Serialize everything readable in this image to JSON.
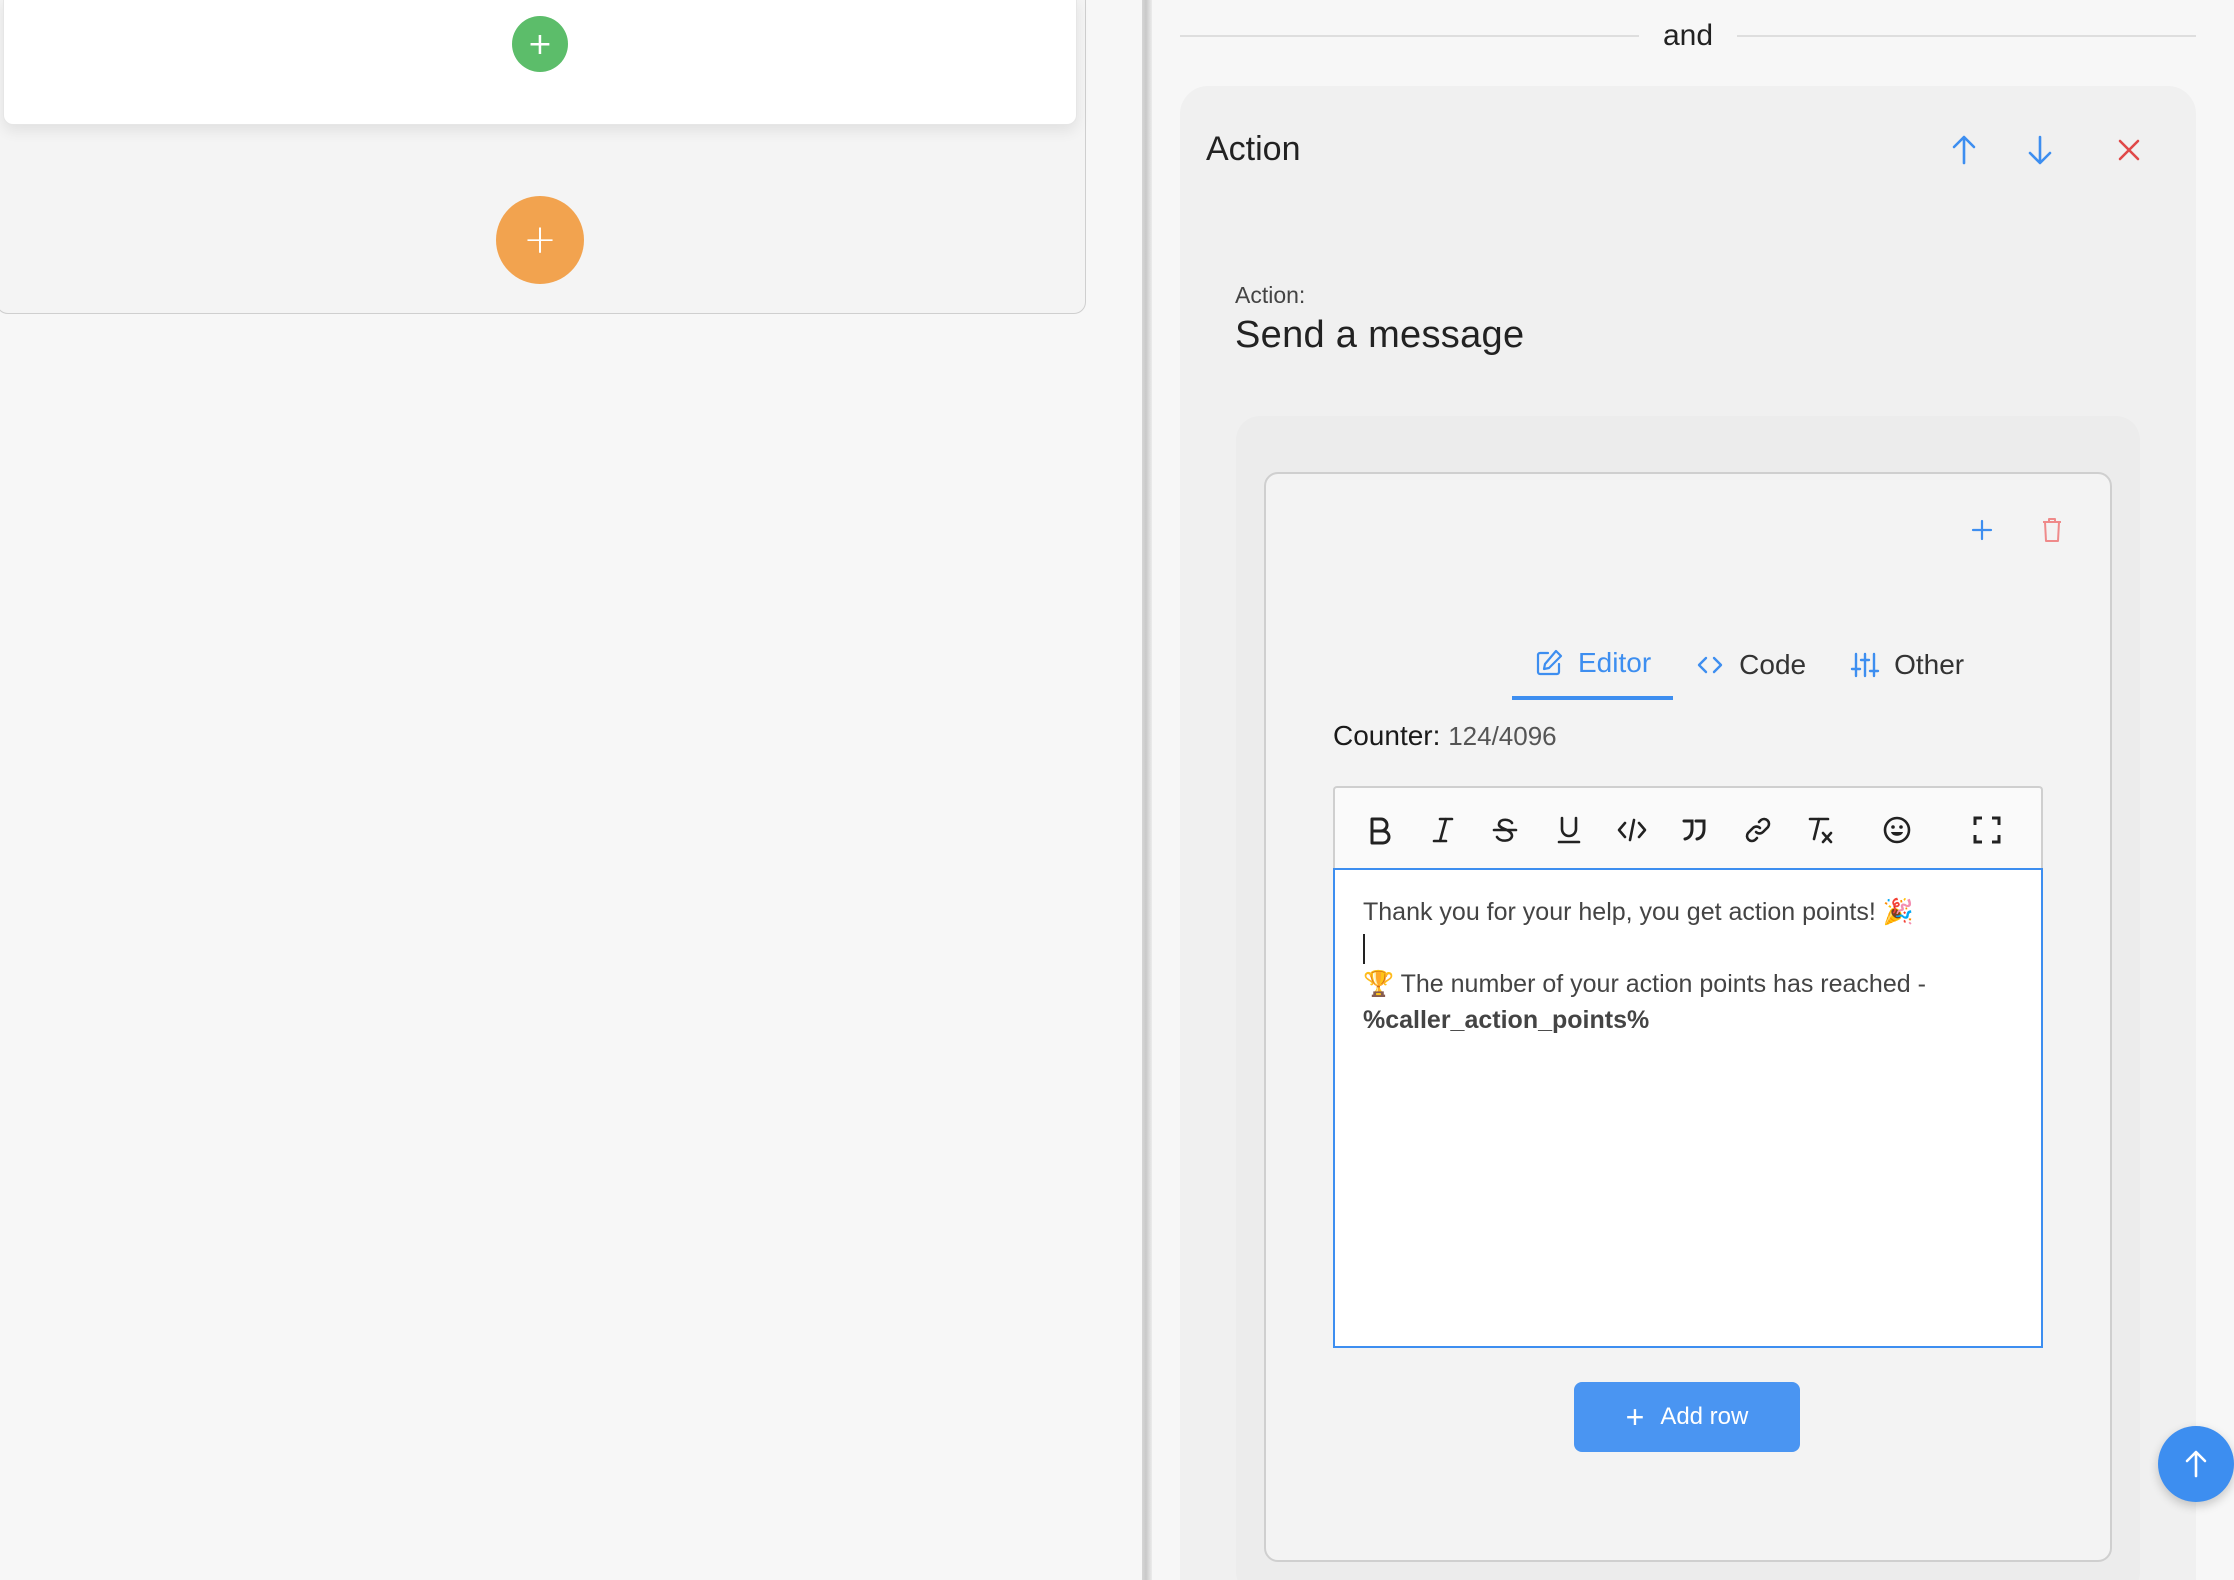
{
  "left_panel": {
    "add_inner_symbol": "+",
    "add_block_symbol": "+"
  },
  "separator": {
    "label": "and"
  },
  "action_block": {
    "title": "Action",
    "action_label": "Action:",
    "action_value": "Send a message"
  },
  "message_card": {
    "tabs": [
      {
        "label": "Editor",
        "icon": "edit-icon",
        "active": true
      },
      {
        "label": "Code",
        "icon": "code-brackets-icon",
        "active": false
      },
      {
        "label": "Other",
        "icon": "sliders-icon",
        "active": false
      }
    ],
    "counter_label": "Counter:",
    "counter_value": "124/4096",
    "toolbar": [
      "bold-icon",
      "italic-icon",
      "strikethrough-icon",
      "underline-icon",
      "code-icon",
      "quote-icon",
      "link-icon",
      "clear-format-icon",
      "emoji-icon",
      "fullscreen-icon"
    ],
    "editor": {
      "line1": "Thank you for your help, you get action points! 🎉",
      "line3_prefix": "🏆  The number of your action points has reached -",
      "line4_bold": "%caller_action_points%"
    },
    "add_row_label": "Add row"
  },
  "colors": {
    "accent": "#3d8ef0",
    "green": "#5cbd6a",
    "orange": "#f2a34f",
    "danger": "#e04848"
  }
}
